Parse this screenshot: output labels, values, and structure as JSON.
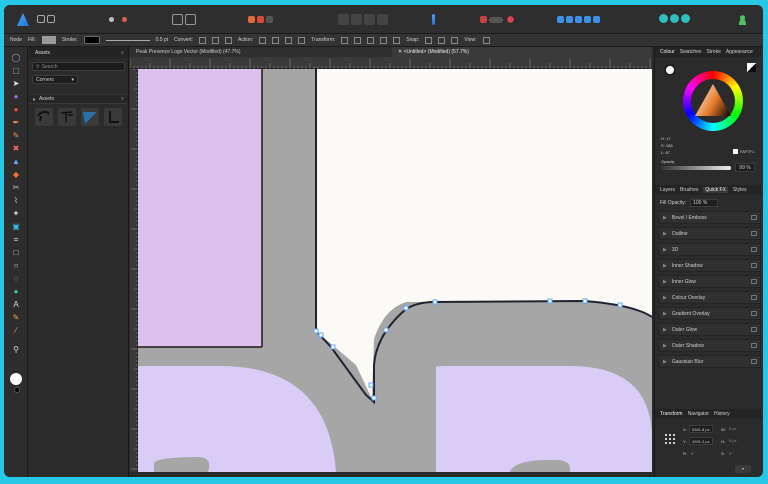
{
  "app": {
    "name": "Affinity Designer"
  },
  "colors": {
    "frame": "#26c8e6",
    "artboard": "#fcfaf6",
    "lilac": "#dcc0ee",
    "lilac_soft": "#d7ccf6",
    "gray": "#a6a6a6",
    "node": "#5aa7ff"
  },
  "context_bar": {
    "node_label": "Node",
    "fill_label": "Fill:",
    "stroke_label": "Stroke:",
    "stroke_width": "0.5 pt",
    "convert_label": "Convert:",
    "action_label": "Action:",
    "transform_label": "Transform:",
    "snap_label": "Snap:",
    "view_label": "View:"
  },
  "assets_panel": {
    "tab": "Assets",
    "search_placeholder": "Search",
    "category": "Corners",
    "section": "Assets"
  },
  "doc_tabs": [
    {
      "label": "Peak Presence Logo Vector (Modified) (47.7%)"
    },
    {
      "label": "<Untitled> (Modified) (57.7%)"
    }
  ],
  "color_panel": {
    "tabs": [
      "Colour",
      "Swatches",
      "Stroke",
      "Appearance"
    ],
    "h": "H: 17",
    "s": "S: 188",
    "l": "L: 67",
    "hex": "FAF7F1",
    "opacity_label": "Opacity",
    "opacity_value": "99 %"
  },
  "fx_panel": {
    "tabs": [
      "Layers",
      "Brushes",
      "Quick FX",
      "Styles"
    ],
    "fill_opacity_label": "Fill Opacity:",
    "fill_opacity_value": "100 %",
    "effects": [
      "Bevel / Emboss",
      "Outline",
      "3D",
      "Inner Shadow",
      "Inner Glow",
      "Colour Overlay",
      "Gradient Overlay",
      "Outer Glow",
      "Outer Shadow",
      "Gaussian Blur"
    ]
  },
  "transform_panel": {
    "tabs": [
      "Transform",
      "Navigator",
      "History"
    ],
    "x_label": "X:",
    "x_value": "5361.8 px",
    "y_label": "Y:",
    "y_value": "4391.2 px",
    "w_label": "W:",
    "w_value": "0 px",
    "h_label": "H:",
    "h_value": "0 px",
    "r_label": "R:",
    "r_value": "0°",
    "s_label": "S:",
    "s_value": "0°"
  }
}
